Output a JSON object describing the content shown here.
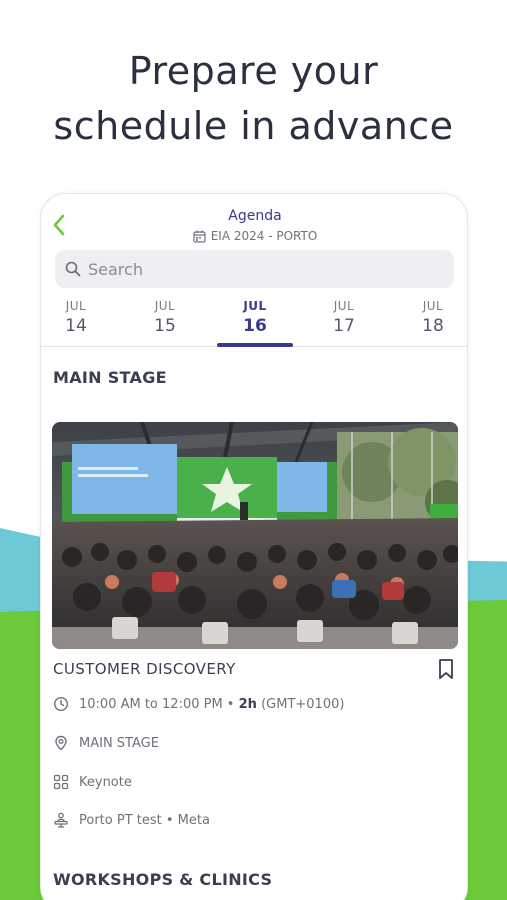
{
  "headline": {
    "line1": "Prepare your",
    "line2": "schedule in advance"
  },
  "appbar": {
    "title": "Agenda",
    "subtitle": "EIA 2024 - PORTO"
  },
  "search": {
    "placeholder": "Search"
  },
  "dates": [
    {
      "month": "JUL",
      "day": "14"
    },
    {
      "month": "JUL",
      "day": "15"
    },
    {
      "month": "JUL",
      "day": "16",
      "active": true
    },
    {
      "month": "JUL",
      "day": "17"
    },
    {
      "month": "JUL",
      "day": "18"
    }
  ],
  "sections": {
    "main_stage": "MAIN STAGE",
    "workshops": "WORKSHOPS & CLINICS"
  },
  "session": {
    "title": "CUSTOMER DISCOVERY",
    "time": "10:00 AM to 12:00 PM •",
    "duration": "2h",
    "timezone": "(GMT+0100)",
    "location": "MAIN STAGE",
    "type": "Keynote",
    "speakers": "Porto PT test • Meta"
  },
  "colors": {
    "accent": "#3a3a8c",
    "back_arrow": "#6cc93a",
    "teal": "#6ec9d6",
    "green": "#6cc93a"
  },
  "icons": {
    "back": "chevron-left-icon",
    "calendar": "calendar-icon",
    "search": "search-icon",
    "bookmark": "bookmark-icon",
    "clock": "clock-icon",
    "location": "location-pin-icon",
    "type": "grid-icon",
    "speakers": "person-stand-icon"
  }
}
